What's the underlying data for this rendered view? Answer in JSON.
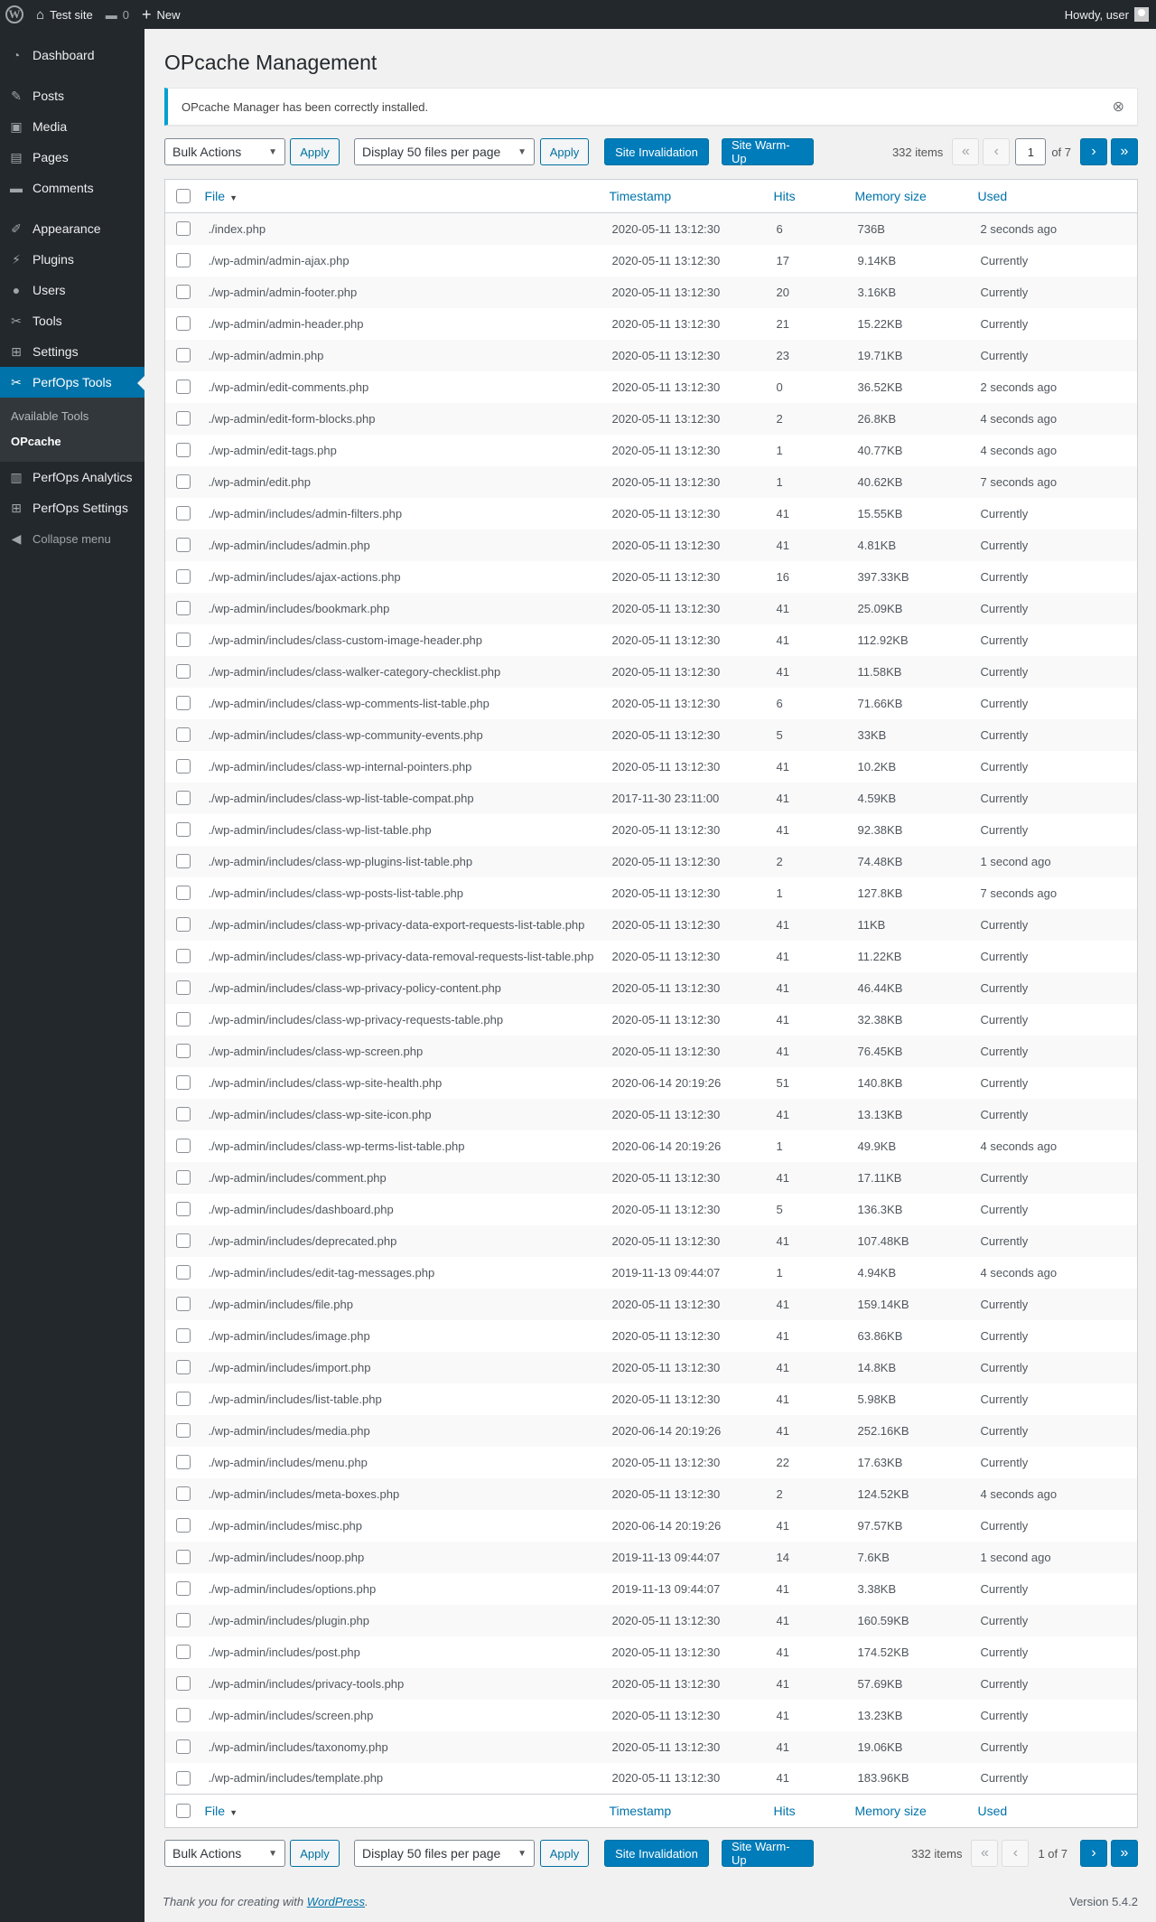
{
  "admin_bar": {
    "site_name": "Test site",
    "comments_count": "0",
    "new_label": "New",
    "howdy": "Howdy, user"
  },
  "sidebar": {
    "items": [
      {
        "label": "Dashboard",
        "icon": "dashboard-icon"
      },
      {
        "label": "Posts",
        "icon": "pin-icon"
      },
      {
        "label": "Media",
        "icon": "media-icon"
      },
      {
        "label": "Pages",
        "icon": "page-icon"
      },
      {
        "label": "Comments",
        "icon": "comment-icon"
      },
      {
        "label": "Appearance",
        "icon": "brush-icon"
      },
      {
        "label": "Plugins",
        "icon": "plugin-icon"
      },
      {
        "label": "Users",
        "icon": "user-icon"
      },
      {
        "label": "Tools",
        "icon": "wrench-icon"
      },
      {
        "label": "Settings",
        "icon": "settings-icon"
      },
      {
        "label": "PerfOps Tools",
        "icon": "wrench-icon"
      },
      {
        "label": "PerfOps Analytics",
        "icon": "chart-icon"
      },
      {
        "label": "PerfOps Settings",
        "icon": "settings-icon"
      }
    ],
    "submenu": [
      "Available Tools",
      "OPcache"
    ],
    "collapse": "Collapse menu"
  },
  "page": {
    "title": "OPcache Management",
    "notice": "OPcache Manager has been correctly installed."
  },
  "toolbar": {
    "bulk_actions": "Bulk Actions",
    "apply": "Apply",
    "per_page": "Display 50 files per page",
    "site_invalidation": "Site Invalidation",
    "site_warmup": "Site Warm-Up",
    "items_count": "332 items",
    "current_page": "1",
    "of_pages": "of 7",
    "page_of_text": "1 of 7"
  },
  "table": {
    "columns": {
      "file": "File",
      "timestamp": "Timestamp",
      "hits": "Hits",
      "memory": "Memory size",
      "used": "Used"
    },
    "rows": [
      [
        "./index.php",
        "2020-05-11 13:12:30",
        "6",
        "736B",
        "2 seconds ago"
      ],
      [
        "./wp-admin/admin-ajax.php",
        "2020-05-11 13:12:30",
        "17",
        "9.14KB",
        "Currently"
      ],
      [
        "./wp-admin/admin-footer.php",
        "2020-05-11 13:12:30",
        "20",
        "3.16KB",
        "Currently"
      ],
      [
        "./wp-admin/admin-header.php",
        "2020-05-11 13:12:30",
        "21",
        "15.22KB",
        "Currently"
      ],
      [
        "./wp-admin/admin.php",
        "2020-05-11 13:12:30",
        "23",
        "19.71KB",
        "Currently"
      ],
      [
        "./wp-admin/edit-comments.php",
        "2020-05-11 13:12:30",
        "0",
        "36.52KB",
        "2 seconds ago"
      ],
      [
        "./wp-admin/edit-form-blocks.php",
        "2020-05-11 13:12:30",
        "2",
        "26.8KB",
        "4 seconds ago"
      ],
      [
        "./wp-admin/edit-tags.php",
        "2020-05-11 13:12:30",
        "1",
        "40.77KB",
        "4 seconds ago"
      ],
      [
        "./wp-admin/edit.php",
        "2020-05-11 13:12:30",
        "1",
        "40.62KB",
        "7 seconds ago"
      ],
      [
        "./wp-admin/includes/admin-filters.php",
        "2020-05-11 13:12:30",
        "41",
        "15.55KB",
        "Currently"
      ],
      [
        "./wp-admin/includes/admin.php",
        "2020-05-11 13:12:30",
        "41",
        "4.81KB",
        "Currently"
      ],
      [
        "./wp-admin/includes/ajax-actions.php",
        "2020-05-11 13:12:30",
        "16",
        "397.33KB",
        "Currently"
      ],
      [
        "./wp-admin/includes/bookmark.php",
        "2020-05-11 13:12:30",
        "41",
        "25.09KB",
        "Currently"
      ],
      [
        "./wp-admin/includes/class-custom-image-header.php",
        "2020-05-11 13:12:30",
        "41",
        "112.92KB",
        "Currently"
      ],
      [
        "./wp-admin/includes/class-walker-category-checklist.php",
        "2020-05-11 13:12:30",
        "41",
        "11.58KB",
        "Currently"
      ],
      [
        "./wp-admin/includes/class-wp-comments-list-table.php",
        "2020-05-11 13:12:30",
        "6",
        "71.66KB",
        "Currently"
      ],
      [
        "./wp-admin/includes/class-wp-community-events.php",
        "2020-05-11 13:12:30",
        "5",
        "33KB",
        "Currently"
      ],
      [
        "./wp-admin/includes/class-wp-internal-pointers.php",
        "2020-05-11 13:12:30",
        "41",
        "10.2KB",
        "Currently"
      ],
      [
        "./wp-admin/includes/class-wp-list-table-compat.php",
        "2017-11-30 23:11:00",
        "41",
        "4.59KB",
        "Currently"
      ],
      [
        "./wp-admin/includes/class-wp-list-table.php",
        "2020-05-11 13:12:30",
        "41",
        "92.38KB",
        "Currently"
      ],
      [
        "./wp-admin/includes/class-wp-plugins-list-table.php",
        "2020-05-11 13:12:30",
        "2",
        "74.48KB",
        "1 second ago"
      ],
      [
        "./wp-admin/includes/class-wp-posts-list-table.php",
        "2020-05-11 13:12:30",
        "1",
        "127.8KB",
        "7 seconds ago"
      ],
      [
        "./wp-admin/includes/class-wp-privacy-data-export-requests-list-table.php",
        "2020-05-11 13:12:30",
        "41",
        "11KB",
        "Currently"
      ],
      [
        "./wp-admin/includes/class-wp-privacy-data-removal-requests-list-table.php",
        "2020-05-11 13:12:30",
        "41",
        "11.22KB",
        "Currently"
      ],
      [
        "./wp-admin/includes/class-wp-privacy-policy-content.php",
        "2020-05-11 13:12:30",
        "41",
        "46.44KB",
        "Currently"
      ],
      [
        "./wp-admin/includes/class-wp-privacy-requests-table.php",
        "2020-05-11 13:12:30",
        "41",
        "32.38KB",
        "Currently"
      ],
      [
        "./wp-admin/includes/class-wp-screen.php",
        "2020-05-11 13:12:30",
        "41",
        "76.45KB",
        "Currently"
      ],
      [
        "./wp-admin/includes/class-wp-site-health.php",
        "2020-06-14 20:19:26",
        "51",
        "140.8KB",
        "Currently"
      ],
      [
        "./wp-admin/includes/class-wp-site-icon.php",
        "2020-05-11 13:12:30",
        "41",
        "13.13KB",
        "Currently"
      ],
      [
        "./wp-admin/includes/class-wp-terms-list-table.php",
        "2020-06-14 20:19:26",
        "1",
        "49.9KB",
        "4 seconds ago"
      ],
      [
        "./wp-admin/includes/comment.php",
        "2020-05-11 13:12:30",
        "41",
        "17.11KB",
        "Currently"
      ],
      [
        "./wp-admin/includes/dashboard.php",
        "2020-05-11 13:12:30",
        "5",
        "136.3KB",
        "Currently"
      ],
      [
        "./wp-admin/includes/deprecated.php",
        "2020-05-11 13:12:30",
        "41",
        "107.48KB",
        "Currently"
      ],
      [
        "./wp-admin/includes/edit-tag-messages.php",
        "2019-11-13 09:44:07",
        "1",
        "4.94KB",
        "4 seconds ago"
      ],
      [
        "./wp-admin/includes/file.php",
        "2020-05-11 13:12:30",
        "41",
        "159.14KB",
        "Currently"
      ],
      [
        "./wp-admin/includes/image.php",
        "2020-05-11 13:12:30",
        "41",
        "63.86KB",
        "Currently"
      ],
      [
        "./wp-admin/includes/import.php",
        "2020-05-11 13:12:30",
        "41",
        "14.8KB",
        "Currently"
      ],
      [
        "./wp-admin/includes/list-table.php",
        "2020-05-11 13:12:30",
        "41",
        "5.98KB",
        "Currently"
      ],
      [
        "./wp-admin/includes/media.php",
        "2020-06-14 20:19:26",
        "41",
        "252.16KB",
        "Currently"
      ],
      [
        "./wp-admin/includes/menu.php",
        "2020-05-11 13:12:30",
        "22",
        "17.63KB",
        "Currently"
      ],
      [
        "./wp-admin/includes/meta-boxes.php",
        "2020-05-11 13:12:30",
        "2",
        "124.52KB",
        "4 seconds ago"
      ],
      [
        "./wp-admin/includes/misc.php",
        "2020-06-14 20:19:26",
        "41",
        "97.57KB",
        "Currently"
      ],
      [
        "./wp-admin/includes/noop.php",
        "2019-11-13 09:44:07",
        "14",
        "7.6KB",
        "1 second ago"
      ],
      [
        "./wp-admin/includes/options.php",
        "2019-11-13 09:44:07",
        "41",
        "3.38KB",
        "Currently"
      ],
      [
        "./wp-admin/includes/plugin.php",
        "2020-05-11 13:12:30",
        "41",
        "160.59KB",
        "Currently"
      ],
      [
        "./wp-admin/includes/post.php",
        "2020-05-11 13:12:30",
        "41",
        "174.52KB",
        "Currently"
      ],
      [
        "./wp-admin/includes/privacy-tools.php",
        "2020-05-11 13:12:30",
        "41",
        "57.69KB",
        "Currently"
      ],
      [
        "./wp-admin/includes/screen.php",
        "2020-05-11 13:12:30",
        "41",
        "13.23KB",
        "Currently"
      ],
      [
        "./wp-admin/includes/taxonomy.php",
        "2020-05-11 13:12:30",
        "41",
        "19.06KB",
        "Currently"
      ],
      [
        "./wp-admin/includes/template.php",
        "2020-05-11 13:12:30",
        "41",
        "183.96KB",
        "Currently"
      ]
    ]
  },
  "footer": {
    "thanks_prefix": "Thank you for creating with ",
    "wordpress_link": "WordPress",
    "thanks_suffix": ".",
    "version": "Version 5.4.2"
  },
  "colors": {
    "admin_bar": "#23282d",
    "accent": "#0073aa",
    "primary_button": "#007cba",
    "notice_border": "#00a0d2"
  }
}
